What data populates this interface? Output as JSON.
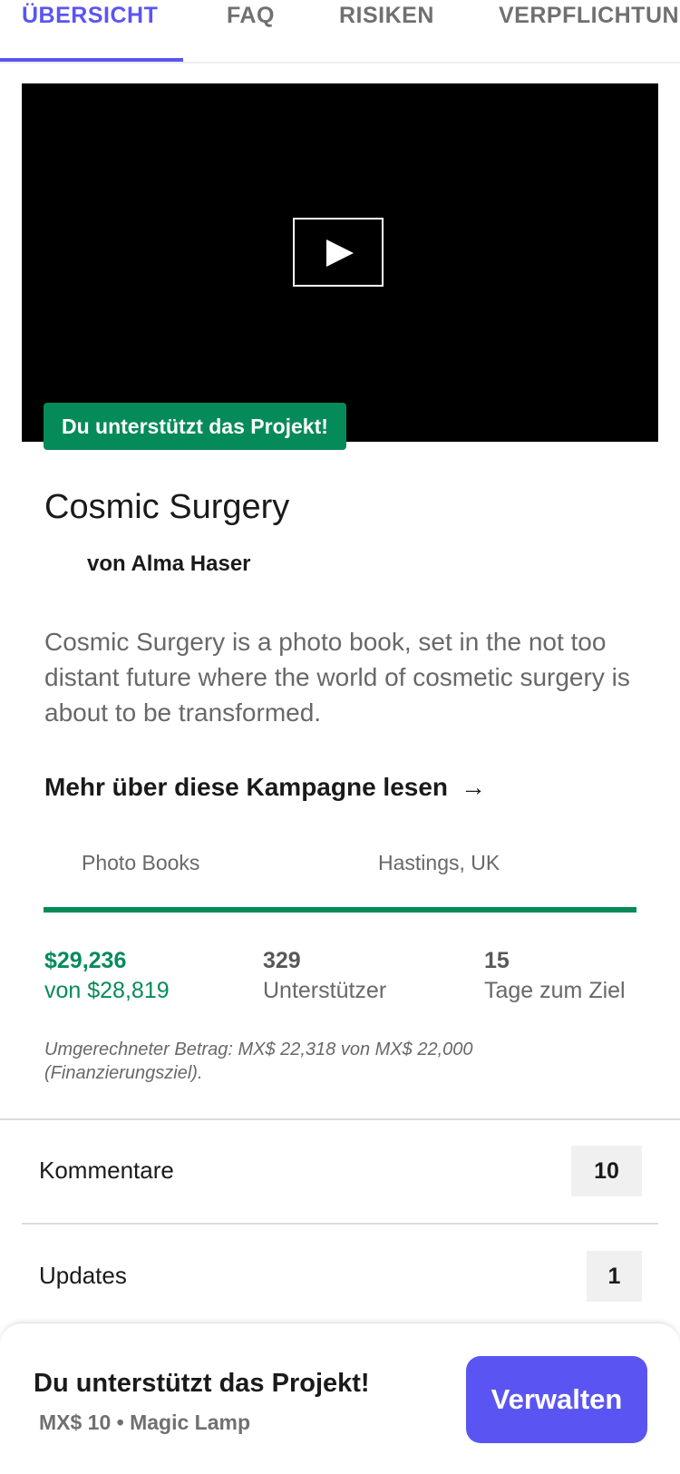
{
  "tabs": [
    {
      "label": "ÜBERSICHT",
      "active": true
    },
    {
      "label": "FAQ",
      "active": false
    },
    {
      "label": "RISIKEN",
      "active": false
    },
    {
      "label": "VERPFLICHTUNGEN",
      "active": false
    }
  ],
  "video": {
    "play_icon": "play-icon"
  },
  "backer_badge": "Du unterstützt das Projekt!",
  "project": {
    "title": "Cosmic Surgery",
    "creator": "von Alma Haser",
    "blurb": "Cosmic Surgery is a photo book, set in the not too distant future where the world of cosmetic surgery is about to be transformed.",
    "read_more": "Mehr über diese Kampagne lesen",
    "read_more_icon": "arrow-right-icon",
    "category": "Photo Books",
    "location": "Hastings, UK"
  },
  "funding": {
    "progress": 1.0,
    "pledged": "$29,236",
    "goal": "von $28,819",
    "backers_count": "329",
    "backers_label": "Unterstützer",
    "days_count": "15",
    "days_label": "Tage zum Ziel",
    "converted_note": "Umgerechneter Betrag: MX$ 22,318 von MX$ 22,000 (Finanzierungsziel)."
  },
  "rows": [
    {
      "label": "Kommentare",
      "count": "10"
    },
    {
      "label": "Updates",
      "count": "1"
    }
  ],
  "bottom_bar": {
    "title": "Du unterstützt das Projekt!",
    "subtitle": "MX$ 10 • Magic Lamp",
    "button": "Verwalten"
  },
  "colors": {
    "accent": "#5a55f2",
    "success": "#058b59"
  }
}
